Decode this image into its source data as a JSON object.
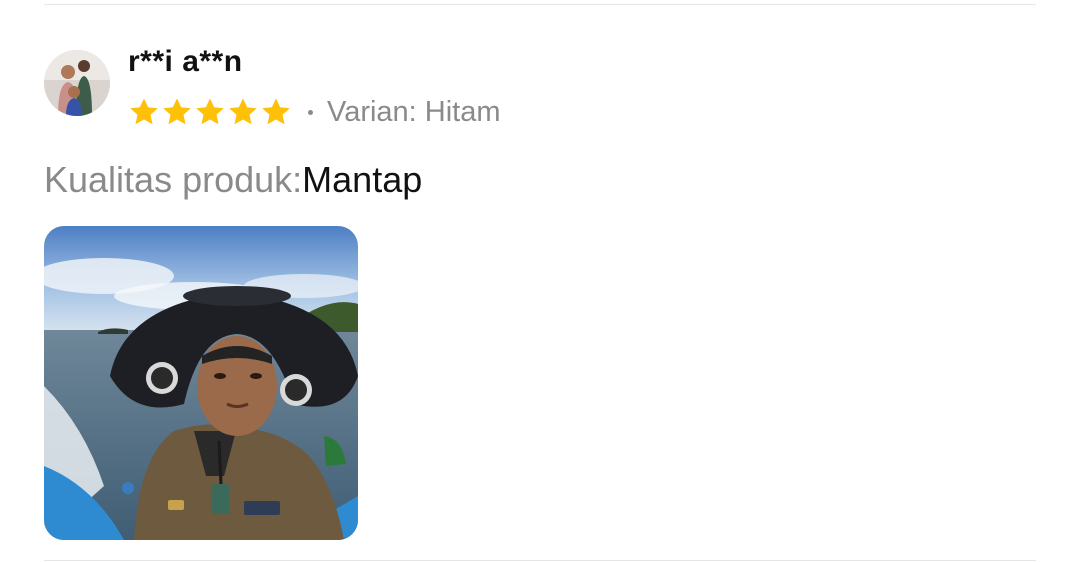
{
  "review": {
    "username": "r**i a**n",
    "rating": 5,
    "rating_max": 5,
    "variant_text": "Varian: Hitam",
    "quality_label": "Kualitas produk:",
    "quality_value": "Mantap"
  },
  "colors": {
    "star": "#FFC107",
    "muted_text": "#8a8a8a",
    "primary_text": "#111111",
    "divider": "#e6e6e6"
  },
  "icons": {
    "star": "star-icon"
  }
}
